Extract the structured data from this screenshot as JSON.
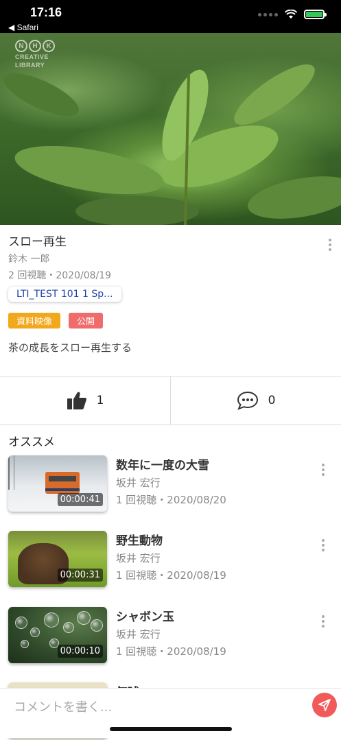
{
  "status_bar": {
    "time": "17:16",
    "back_label": "◀ Safari"
  },
  "video": {
    "logo_letters": [
      "N",
      "H",
      "K"
    ],
    "logo_line1": "CREATIVE",
    "logo_line2": "LIBRARY"
  },
  "info": {
    "title": "スロー再生",
    "author": "鈴木 一郎",
    "views": "2 回視聴・2020/08/19",
    "course_chip": "LTI_TEST 101 1 Sp...",
    "tags": [
      "資料映像",
      "公開"
    ],
    "description": "茶の成長をスロー再生する"
  },
  "actions": {
    "likes": "1",
    "comments": "0"
  },
  "recommend": {
    "heading": "オススメ",
    "items": [
      {
        "title": "数年に一度の大雪",
        "author": "坂井 宏行",
        "views": "1 回視聴・2020/08/20",
        "duration": "00:00:41"
      },
      {
        "title": "野生動物",
        "author": "坂井 宏行",
        "views": "1 回視聴・2020/08/19",
        "duration": "00:00:31"
      },
      {
        "title": "シャボン玉",
        "author": "坂井 宏行",
        "views": "1 回視聴・2020/08/19",
        "duration": "00:00:10"
      },
      {
        "title": "気球"
      }
    ]
  },
  "comment": {
    "placeholder": "コメントを書く..."
  },
  "colors": {
    "accent_red": "#f25a5a",
    "tag_orange": "#f2a81d",
    "tag_red": "#f06c6c",
    "chip_text": "#1f3fa8"
  }
}
